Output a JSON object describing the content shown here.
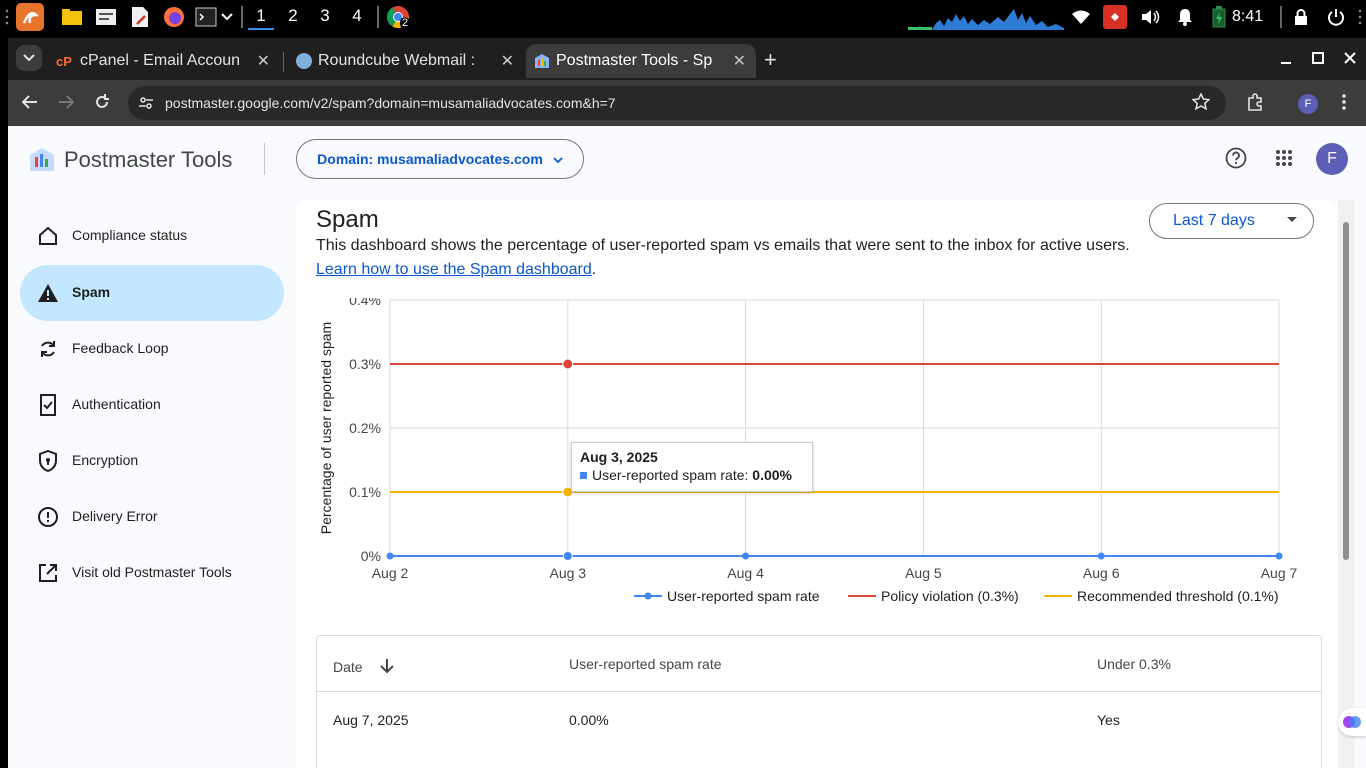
{
  "taskbar": {
    "workspaces": [
      "1",
      "2",
      "3",
      "4"
    ],
    "active_workspace": "1",
    "chrome_badge": "2",
    "clock": "8:41"
  },
  "browser": {
    "tabs": [
      {
        "title": "cPanel - Email Accoun",
        "icon": "cpanel-icon",
        "active": false
      },
      {
        "title": "Roundcube Webmail :",
        "icon": "roundcube-icon",
        "active": false
      },
      {
        "title": "Postmaster Tools - Sp",
        "icon": "postmaster-icon",
        "active": true
      }
    ],
    "url": "postmaster.google.com/v2/spam?domain=musamaliadvocates.com&h=7",
    "profile_initial": "F"
  },
  "header": {
    "app_name": "Postmaster Tools",
    "domain_label": "Domain: musamaliadvocates.com",
    "avatar_initial": "F"
  },
  "sidebar": {
    "items": [
      {
        "label": "Compliance status",
        "icon": "home-icon",
        "active": false
      },
      {
        "label": "Spam",
        "icon": "warning-icon",
        "active": true
      },
      {
        "label": "Feedback Loop",
        "icon": "sync-icon",
        "active": false
      },
      {
        "label": "Authentication",
        "icon": "checklist-icon",
        "active": false
      },
      {
        "label": "Encryption",
        "icon": "shield-icon",
        "active": false
      },
      {
        "label": "Delivery Error",
        "icon": "error-icon",
        "active": false
      },
      {
        "label": "Visit old Postmaster Tools",
        "icon": "open-external-icon",
        "active": false
      }
    ]
  },
  "main": {
    "title": "Spam",
    "description": "This dashboard shows the percentage of user-reported spam vs emails that were sent to the inbox for active users.",
    "link_text": "Learn how to use the Spam dashboard",
    "date_range": "Last 7 days"
  },
  "chart_data": {
    "type": "line",
    "title": "",
    "xlabel": "",
    "ylabel": "Percentage of user reported spam",
    "categories": [
      "Aug 2",
      "Aug 3",
      "Aug 4",
      "Aug 5",
      "Aug 6",
      "Aug 7"
    ],
    "y_ticks": [
      "0%",
      "0.1%",
      "0.2%",
      "0.3%",
      "0.4%"
    ],
    "ylim": [
      0,
      0.4
    ],
    "grid": true,
    "legend_position": "bottom-right",
    "series": [
      {
        "name": "User-reported spam rate",
        "values": [
          0,
          0,
          0,
          null,
          0,
          0
        ],
        "color": "#4285f4",
        "markers": true
      },
      {
        "name": "Policy violation (0.3%)",
        "values": [
          0.3,
          0.3,
          0.3,
          0.3,
          0.3,
          0.3
        ],
        "color": "#db4437",
        "markers": false
      },
      {
        "name": "Recommended threshold (0.1%)",
        "values": [
          0.1,
          0.1,
          0.1,
          0.1,
          0.1,
          0.1
        ],
        "color": "#f4b400",
        "markers": false
      }
    ],
    "tooltip": {
      "date": "Aug 3, 2025",
      "label": "User-reported spam rate:",
      "value": "0.00%"
    }
  },
  "table": {
    "headers": [
      "Date",
      "User-reported spam rate",
      "Under 0.3%"
    ],
    "rows": [
      [
        "Aug 7, 2025",
        "0.00%",
        "Yes"
      ]
    ]
  },
  "colors": {
    "accent": "#0b57d0",
    "nav_active_bg": "#c2e7ff",
    "page_bg": "#f8fafd"
  }
}
